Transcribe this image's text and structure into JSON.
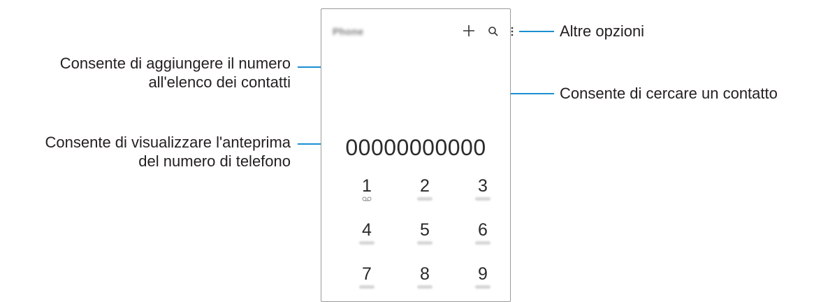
{
  "phone": {
    "app_title": "Phone",
    "number_preview": "00000000000",
    "keys": [
      {
        "digit": "1",
        "sub": "voicemail"
      },
      {
        "digit": "2",
        "sub": ""
      },
      {
        "digit": "3",
        "sub": ""
      },
      {
        "digit": "4",
        "sub": ""
      },
      {
        "digit": "5",
        "sub": ""
      },
      {
        "digit": "6",
        "sub": ""
      },
      {
        "digit": "7",
        "sub": ""
      },
      {
        "digit": "8",
        "sub": ""
      },
      {
        "digit": "9",
        "sub": ""
      }
    ],
    "icons": [
      "plus-icon",
      "search-icon",
      "more-options-icon",
      "voicemail-icon"
    ]
  },
  "callouts": {
    "add_contact": {
      "line1": "Consente di aggiungere il numero",
      "line2": "all'elenco dei contatti"
    },
    "preview_number": {
      "line1": "Consente di visualizzare l'anteprima",
      "line2": "del numero di telefono"
    },
    "more_options": "Altre opzioni",
    "search_contact": "Consente di cercare un contatto"
  },
  "colors": {
    "leader_line": "#1a8fd0",
    "text": "#231f20",
    "frame": "#9a9a9a"
  }
}
